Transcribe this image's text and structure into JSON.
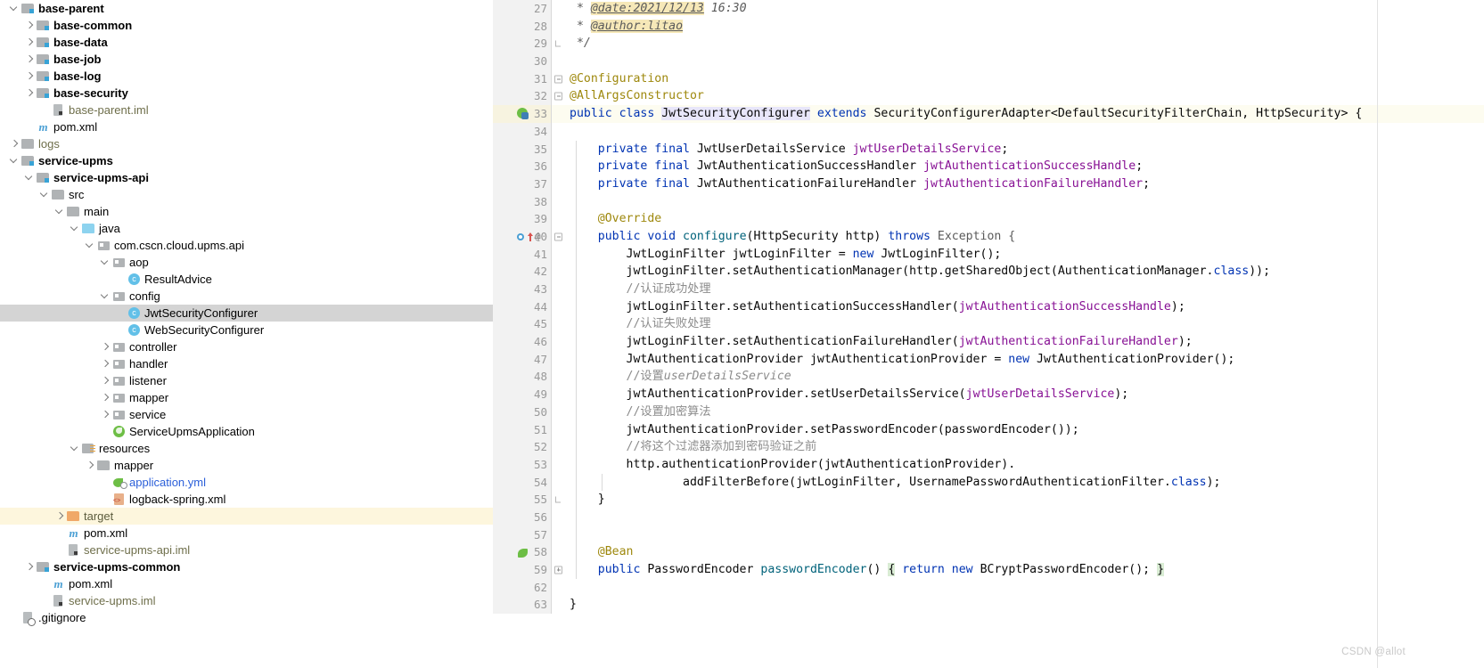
{
  "theme": {
    "background": "#ffffff",
    "gutter_bg": "#f2f2f2",
    "caret_line_bg": "#fdfcf0",
    "selection_bg": "#d4d4d4",
    "keyword_color": "#0033b3",
    "annotation_color": "#9e880d",
    "comment_color": "#8c8c8c",
    "field_color": "#871094",
    "method_color": "#00627a",
    "class_highlight": "#e8e6fa",
    "fold_brace_bg": "#d9ecd4",
    "target_folder_row": "#fdf6dd"
  },
  "project_tree": {
    "name": "Project",
    "rows": [
      {
        "indent": 1,
        "twisty": "expanded",
        "icon": "module-folder-icon",
        "label": "base-parent",
        "style": "bold"
      },
      {
        "indent": 2,
        "twisty": "collapsed",
        "icon": "module-folder-icon",
        "label": "base-common",
        "style": "bold"
      },
      {
        "indent": 2,
        "twisty": "collapsed",
        "icon": "module-folder-icon",
        "label": "base-data",
        "style": "bold"
      },
      {
        "indent": 2,
        "twisty": "collapsed",
        "icon": "module-folder-icon",
        "label": "base-job",
        "style": "bold"
      },
      {
        "indent": 2,
        "twisty": "collapsed",
        "icon": "module-folder-icon",
        "label": "base-log",
        "style": "bold"
      },
      {
        "indent": 2,
        "twisty": "collapsed",
        "icon": "module-folder-icon",
        "label": "base-security",
        "style": "bold"
      },
      {
        "indent": 3,
        "twisty": "none",
        "icon": "iml-file-icon",
        "label": "base-parent.iml",
        "style": "module-file"
      },
      {
        "indent": 2,
        "twisty": "none",
        "icon": "maven-pom-icon",
        "label": "pom.xml",
        "style": "normal"
      },
      {
        "indent": 1,
        "twisty": "collapsed",
        "icon": "folder-grey-icon",
        "label": "logs",
        "style": "grey-folder"
      },
      {
        "indent": 1,
        "twisty": "expanded",
        "icon": "module-folder-icon",
        "label": "service-upms",
        "style": "bold"
      },
      {
        "indent": 2,
        "twisty": "expanded",
        "icon": "module-folder-icon",
        "label": "service-upms-api",
        "style": "bold"
      },
      {
        "indent": 3,
        "twisty": "expanded",
        "icon": "folder-grey-icon",
        "label": "src",
        "style": "normal"
      },
      {
        "indent": 4,
        "twisty": "expanded",
        "icon": "folder-grey-icon",
        "label": "main",
        "style": "normal"
      },
      {
        "indent": 5,
        "twisty": "expanded",
        "icon": "folder-blue-icon",
        "label": "java",
        "style": "normal"
      },
      {
        "indent": 6,
        "twisty": "expanded",
        "icon": "package-icon",
        "label": "com.cscn.cloud.upms.api",
        "style": "normal"
      },
      {
        "indent": 7,
        "twisty": "expanded",
        "icon": "package-icon",
        "label": "aop",
        "style": "normal"
      },
      {
        "indent": 8,
        "twisty": "none",
        "icon": "java-class-icon",
        "label": "ResultAdvice",
        "style": "normal"
      },
      {
        "indent": 7,
        "twisty": "expanded",
        "icon": "package-icon",
        "label": "config",
        "style": "normal"
      },
      {
        "indent": 8,
        "twisty": "none",
        "icon": "java-class-icon",
        "label": "JwtSecurityConfigurer",
        "style": "normal",
        "selected": true
      },
      {
        "indent": 8,
        "twisty": "none",
        "icon": "java-class-icon",
        "label": "WebSecurityConfigurer",
        "style": "normal"
      },
      {
        "indent": 7,
        "twisty": "collapsed",
        "icon": "package-icon",
        "label": "controller",
        "style": "normal"
      },
      {
        "indent": 7,
        "twisty": "collapsed",
        "icon": "package-icon",
        "label": "handler",
        "style": "normal"
      },
      {
        "indent": 7,
        "twisty": "collapsed",
        "icon": "package-icon",
        "label": "listener",
        "style": "normal"
      },
      {
        "indent": 7,
        "twisty": "collapsed",
        "icon": "package-icon",
        "label": "mapper",
        "style": "normal"
      },
      {
        "indent": 7,
        "twisty": "collapsed",
        "icon": "package-icon",
        "label": "service",
        "style": "normal"
      },
      {
        "indent": 7,
        "twisty": "none",
        "icon": "spring-boot-app-icon",
        "label": "ServiceUpmsApplication",
        "style": "normal"
      },
      {
        "indent": 5,
        "twisty": "expanded",
        "icon": "resources-folder-icon",
        "label": "resources",
        "style": "normal"
      },
      {
        "indent": 6,
        "twisty": "collapsed",
        "icon": "folder-grey-icon",
        "label": "mapper",
        "style": "normal"
      },
      {
        "indent": 7,
        "twisty": "none",
        "icon": "yml-file-icon",
        "label": "application.yml",
        "style": "link"
      },
      {
        "indent": 7,
        "twisty": "none",
        "icon": "xml-file-icon",
        "label": "logback-spring.xml",
        "style": "normal"
      },
      {
        "indent": 4,
        "twisty": "collapsed",
        "icon": "folder-orange-icon",
        "label": "target",
        "style": "target",
        "row_highlight": true
      },
      {
        "indent": 4,
        "twisty": "none",
        "icon": "maven-pom-icon",
        "label": "pom.xml",
        "style": "normal"
      },
      {
        "indent": 4,
        "twisty": "none",
        "icon": "iml-file-icon",
        "label": "service-upms-api.iml",
        "style": "module-file"
      },
      {
        "indent": 2,
        "twisty": "collapsed",
        "icon": "module-folder-icon",
        "label": "service-upms-common",
        "style": "bold"
      },
      {
        "indent": 3,
        "twisty": "none",
        "icon": "maven-pom-icon",
        "label": "pom.xml",
        "style": "normal"
      },
      {
        "indent": 3,
        "twisty": "none",
        "icon": "iml-file-icon",
        "label": "service-upms.iml",
        "style": "module-file"
      },
      {
        "indent": 1,
        "twisty": "none",
        "icon": "gitignore-file-icon",
        "label": ".gitignore",
        "style": "normal"
      }
    ]
  },
  "editor": {
    "file_name": "JwtSecurityConfigurer",
    "margin_guide_column": 992,
    "lines": [
      {
        "number": "27",
        "fold": "none",
        "gutter_icons": [],
        "tokens": [
          {
            "t": " * ",
            "c": "jdoc-txt"
          },
          {
            "t": "@date:2021/12/13",
            "c": "jdoc-tag"
          },
          {
            "t": " 16:30",
            "c": "jdoc-txt"
          }
        ]
      },
      {
        "number": "28",
        "fold": "none",
        "gutter_icons": [],
        "tokens": [
          {
            "t": " * ",
            "c": "jdoc-txt"
          },
          {
            "t": "@author:litao",
            "c": "jdoc-tag"
          }
        ]
      },
      {
        "number": "29",
        "fold": "end-brace",
        "gutter_icons": [],
        "tokens": [
          {
            "t": " */",
            "c": "jdoc-txt"
          }
        ]
      },
      {
        "number": "30",
        "fold": "none",
        "gutter_icons": [],
        "tokens": []
      },
      {
        "number": "31",
        "fold": "minus",
        "gutter_icons": [],
        "tokens": [
          {
            "t": "@Configuration",
            "c": "anno"
          }
        ]
      },
      {
        "number": "32",
        "fold": "minus",
        "gutter_icons": [],
        "tokens": [
          {
            "t": "@AllArgsConstructor",
            "c": "anno"
          }
        ]
      },
      {
        "number": "33",
        "fold": "none",
        "caret": true,
        "gutter_icons": [
          "spring-bean-gutter-icon"
        ],
        "tokens": [
          {
            "t": "public ",
            "c": "kw"
          },
          {
            "t": "class ",
            "c": "kw"
          },
          {
            "t": "JwtSecurityConfigurer",
            "c": "cls-name"
          },
          {
            "t": " ",
            "c": "type"
          },
          {
            "t": "extends ",
            "c": "kw"
          },
          {
            "t": "SecurityConfigurerAdapter<DefaultSecurityFilterChain, HttpSecurity> {",
            "c": "type"
          }
        ]
      },
      {
        "number": "34",
        "fold": "none",
        "gutter_icons": [],
        "tokens": []
      },
      {
        "number": "35",
        "fold": "none",
        "gutter_icons": [],
        "indent": 1,
        "tokens": [
          {
            "t": "    private final ",
            "c": "kw"
          },
          {
            "t": "JwtUserDetailsService ",
            "c": "type"
          },
          {
            "t": "jwtUserDetailsService",
            "c": "field"
          },
          {
            "t": ";",
            "c": "type"
          }
        ]
      },
      {
        "number": "36",
        "fold": "none",
        "gutter_icons": [],
        "indent": 1,
        "tokens": [
          {
            "t": "    private final ",
            "c": "kw"
          },
          {
            "t": "JwtAuthenticationSuccessHandler ",
            "c": "type"
          },
          {
            "t": "jwtAuthenticationSuccessHandle",
            "c": "field"
          },
          {
            "t": ";",
            "c": "type"
          }
        ]
      },
      {
        "number": "37",
        "fold": "none",
        "gutter_icons": [],
        "indent": 1,
        "tokens": [
          {
            "t": "    private final ",
            "c": "kw"
          },
          {
            "t": "JwtAuthenticationFailureHandler ",
            "c": "type"
          },
          {
            "t": "jwtAuthenticationFailureHandler",
            "c": "field"
          },
          {
            "t": ";",
            "c": "type"
          }
        ]
      },
      {
        "number": "38",
        "fold": "none",
        "gutter_icons": [],
        "indent": 1,
        "tokens": []
      },
      {
        "number": "39",
        "fold": "none",
        "gutter_icons": [],
        "indent": 1,
        "tokens": [
          {
            "t": "    @Override",
            "c": "anno"
          }
        ]
      },
      {
        "number": "40",
        "fold": "minus",
        "gutter_icons": [
          "override-marker-icon",
          "implements-arrow-icon",
          "annotation-at-icon"
        ],
        "indent": 1,
        "tokens": [
          {
            "t": "    public void ",
            "c": "kw"
          },
          {
            "t": "configure",
            "c": "method"
          },
          {
            "t": "(HttpSecurity http) ",
            "c": "type"
          },
          {
            "t": "throws ",
            "c": "kw"
          },
          {
            "t": "Exception {",
            "c": "dim"
          }
        ]
      },
      {
        "number": "41",
        "fold": "none",
        "gutter_icons": [],
        "indent": 2,
        "tokens": [
          {
            "t": "        JwtLoginFilter jwtLoginFilter = ",
            "c": "type"
          },
          {
            "t": "new ",
            "c": "kw"
          },
          {
            "t": "JwtLoginFilter();",
            "c": "type"
          }
        ]
      },
      {
        "number": "42",
        "fold": "none",
        "gutter_icons": [],
        "indent": 2,
        "tokens": [
          {
            "t": "        jwtLoginFilter.setAuthenticationManager(http.getSharedObject(AuthenticationManager.",
            "c": "type"
          },
          {
            "t": "class",
            "c": "kw"
          },
          {
            "t": "));",
            "c": "type"
          }
        ]
      },
      {
        "number": "43",
        "fold": "none",
        "gutter_icons": [],
        "indent": 2,
        "tokens": [
          {
            "t": "        //认证成功处理",
            "c": "cmt"
          }
        ]
      },
      {
        "number": "44",
        "fold": "none",
        "gutter_icons": [],
        "indent": 2,
        "tokens": [
          {
            "t": "        jwtLoginFilter.setAuthenticationSuccessHandler(",
            "c": "type"
          },
          {
            "t": "jwtAuthenticationSuccessHandle",
            "c": "field"
          },
          {
            "t": ");",
            "c": "type"
          }
        ]
      },
      {
        "number": "45",
        "fold": "none",
        "gutter_icons": [],
        "indent": 2,
        "tokens": [
          {
            "t": "        //认证失败处理",
            "c": "cmt"
          }
        ]
      },
      {
        "number": "46",
        "fold": "none",
        "gutter_icons": [],
        "indent": 2,
        "tokens": [
          {
            "t": "        jwtLoginFilter.setAuthenticationFailureHandler(",
            "c": "type"
          },
          {
            "t": "jwtAuthenticationFailureHandler",
            "c": "field"
          },
          {
            "t": ");",
            "c": "type"
          }
        ]
      },
      {
        "number": "47",
        "fold": "none",
        "gutter_icons": [],
        "indent": 2,
        "tokens": [
          {
            "t": "        JwtAuthenticationProvider jwtAuthenticationProvider = ",
            "c": "type"
          },
          {
            "t": "new ",
            "c": "kw"
          },
          {
            "t": "JwtAuthenticationProvider();",
            "c": "type"
          }
        ]
      },
      {
        "number": "48",
        "fold": "none",
        "gutter_icons": [],
        "indent": 2,
        "tokens": [
          {
            "t": "        //设置",
            "c": "cmt"
          },
          {
            "t": "userDetailsService",
            "c": "cmt-ital"
          }
        ]
      },
      {
        "number": "49",
        "fold": "none",
        "gutter_icons": [],
        "indent": 2,
        "tokens": [
          {
            "t": "        jwtAuthenticationProvider.setUserDetailsService(",
            "c": "type"
          },
          {
            "t": "jwtUserDetailsService",
            "c": "field"
          },
          {
            "t": ");",
            "c": "type"
          }
        ]
      },
      {
        "number": "50",
        "fold": "none",
        "gutter_icons": [],
        "indent": 2,
        "tokens": [
          {
            "t": "        //设置加密算法",
            "c": "cmt"
          }
        ]
      },
      {
        "number": "51",
        "fold": "none",
        "gutter_icons": [],
        "indent": 2,
        "tokens": [
          {
            "t": "        jwtAuthenticationProvider.setPasswordEncoder(passwordEncoder());",
            "c": "type"
          }
        ]
      },
      {
        "number": "52",
        "fold": "none",
        "gutter_icons": [],
        "indent": 2,
        "tokens": [
          {
            "t": "        //将这个过滤器添加到密码验证之前",
            "c": "cmt"
          }
        ]
      },
      {
        "number": "53",
        "fold": "none",
        "gutter_icons": [],
        "indent": 2,
        "tokens": [
          {
            "t": "        http.authenticationProvider(jwtAuthenticationProvider).",
            "c": "type"
          }
        ]
      },
      {
        "number": "54",
        "fold": "none",
        "gutter_icons": [],
        "indent": 3,
        "tokens": [
          {
            "t": "                addFilterBefore(jwtLoginFilter, UsernamePasswordAuthenticationFilter.",
            "c": "type"
          },
          {
            "t": "class",
            "c": "kw"
          },
          {
            "t": ");",
            "c": "type"
          }
        ]
      },
      {
        "number": "55",
        "fold": "end-brace",
        "gutter_icons": [],
        "indent": 1,
        "tokens": [
          {
            "t": "    }",
            "c": "type"
          }
        ]
      },
      {
        "number": "56",
        "fold": "none",
        "gutter_icons": [],
        "indent": 1,
        "tokens": []
      },
      {
        "number": "57",
        "fold": "none",
        "gutter_icons": [],
        "indent": 1,
        "tokens": []
      },
      {
        "number": "58",
        "fold": "none",
        "gutter_icons": [
          "bean-gutter-icon"
        ],
        "indent": 1,
        "tokens": [
          {
            "t": "    @Bean",
            "c": "anno"
          }
        ]
      },
      {
        "number": "59",
        "fold": "plus",
        "gutter_icons": [],
        "indent": 1,
        "tokens": [
          {
            "t": "    public ",
            "c": "kw"
          },
          {
            "t": "PasswordEncoder ",
            "c": "type"
          },
          {
            "t": "passwordEncoder",
            "c": "method"
          },
          {
            "t": "() ",
            "c": "type"
          },
          {
            "t": "{",
            "c": "fold-brace"
          },
          {
            "t": " ",
            "c": "type"
          },
          {
            "t": "return ",
            "c": "kw"
          },
          {
            "t": "new ",
            "c": "kw"
          },
          {
            "t": "BCryptPasswordEncoder(); ",
            "c": "type"
          },
          {
            "t": "}",
            "c": "fold-brace"
          }
        ]
      },
      {
        "number": "62",
        "fold": "none",
        "gutter_icons": [],
        "tokens": []
      },
      {
        "number": "63",
        "fold": "none",
        "gutter_icons": [],
        "tokens": [
          {
            "t": "}",
            "c": "type"
          }
        ]
      }
    ]
  },
  "watermark": {
    "text": "CSDN @allot"
  }
}
